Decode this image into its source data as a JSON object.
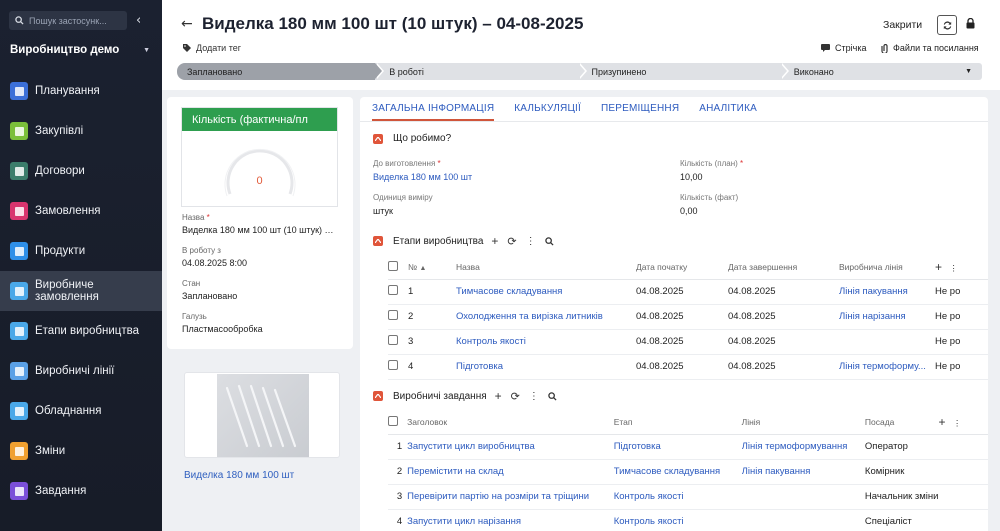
{
  "sidebar": {
    "search_placeholder": "Пошук застосунк...",
    "org": "Виробництво демо",
    "items": [
      {
        "label": "Планування",
        "color": "#3b6fd8",
        "icon": "chart-icon"
      },
      {
        "label": "Закупівлі",
        "color": "#7bbf3a",
        "icon": "doc-icon"
      },
      {
        "label": "Договори",
        "color": "#3b7d6b",
        "icon": "edit-icon"
      },
      {
        "label": "Замовлення",
        "color": "#d8356e",
        "icon": "cart-icon"
      },
      {
        "label": "Продукти",
        "color": "#2f8fe8",
        "icon": "box-icon"
      },
      {
        "label": "Виробниче замовлення",
        "color": "#4aa8e8",
        "icon": "person-icon"
      },
      {
        "label": "Етапи виробництва",
        "color": "#4aa8e8",
        "icon": "list-icon"
      },
      {
        "label": "Виробничі лінії",
        "color": "#5aa0e6",
        "icon": "grid-icon"
      },
      {
        "label": "Обладнання",
        "color": "#4aa8e8",
        "icon": "wrench-icon"
      },
      {
        "label": "Зміни",
        "color": "#f0a030",
        "icon": "calendar-icon"
      },
      {
        "label": "Завдання",
        "color": "#7b4fd8",
        "icon": "flag-icon"
      }
    ]
  },
  "header": {
    "title": "Виделка 180 мм 100 шт (10 штук) – 04-08-2025",
    "close_label": "Закрити",
    "add_tag": "Додати тег",
    "feed": "Стрічка",
    "files": "Файли та посилання"
  },
  "stages": [
    {
      "label": "Заплановано"
    },
    {
      "label": "В роботі"
    },
    {
      "label": "Призупинено"
    },
    {
      "label": "Виконано"
    }
  ],
  "leftcard": {
    "gauge_title": "Кількість (фактична/пл",
    "gauge_value": "0",
    "fields": [
      {
        "label": "Назва",
        "required": "*",
        "value": "Виделка 180 мм 100 шт (10 штук) – 04-08-2025"
      },
      {
        "label": "В роботу з",
        "required": "",
        "value": "04.08.2025 8:00"
      },
      {
        "label": "Стан",
        "required": "",
        "value": "Заплановано"
      },
      {
        "label": "Галузь",
        "required": "",
        "value": "Пластмасообробка"
      }
    ],
    "image_caption": "Виделка 180 мм 100 шт"
  },
  "tabs": [
    "ЗАГАЛЬНА ІНФОРМАЦІЯ",
    "КАЛЬКУЛЯЦІЇ",
    "ПЕРЕМІЩЕННЯ",
    "АНАЛІТИКА"
  ],
  "what": {
    "title": "Що робимо?",
    "f1_label": "До виготовлення",
    "f1_value": "Виделка 180 мм 100 шт",
    "f2_label": "Кількість (план)",
    "f2_value": "10,00",
    "f3_label": "Одиниця виміру",
    "f3_value": "штук",
    "f4_label": "Кількість (факт)",
    "f4_value": "0,00",
    "required": "*"
  },
  "stages_table": {
    "title": "Етапи виробництва",
    "headers": [
      "№",
      "Назва",
      "Дата початку",
      "Дата завершення",
      "Виробнича лінія"
    ],
    "rows": [
      {
        "n": "1",
        "name": "Тимчасове складування",
        "start": "04.08.2025",
        "end": "04.08.2025",
        "line": "Лінія пакування",
        "extra": "Не ро"
      },
      {
        "n": "2",
        "name": "Охолодження та вирізка литників",
        "start": "04.08.2025",
        "end": "04.08.2025",
        "line": "Лінія нарізання",
        "extra": "Не ро"
      },
      {
        "n": "3",
        "name": "Контроль якості",
        "start": "04.08.2025",
        "end": "04.08.2025",
        "line": "",
        "extra": "Не ро"
      },
      {
        "n": "4",
        "name": "Підготовка",
        "start": "04.08.2025",
        "end": "04.08.2025",
        "line": "Лінія термоформу...",
        "extra": "Не ро"
      }
    ]
  },
  "tasks_table": {
    "title": "Виробничі завдання",
    "headers": [
      "Заголовок",
      "Етап",
      "Лінія",
      "Посада"
    ],
    "rows": [
      {
        "n": "1",
        "title": "Запустити цикл виробництва",
        "stage": "Підготовка",
        "line": "Лінія термоформування",
        "role": "Оператор"
      },
      {
        "n": "2",
        "title": "Перемістити на склад",
        "stage": "Тимчасове складування",
        "line": "Лінія пакування",
        "role": "Комірник"
      },
      {
        "n": "3",
        "title": "Перевірити партію на розміри та тріщини",
        "stage": "Контроль якості",
        "line": "",
        "role": "Начальник зміни"
      },
      {
        "n": "4",
        "title": "Запустити цикл нарізання",
        "stage": "Контроль якості",
        "line": "",
        "role": "Спеціаліст"
      }
    ]
  }
}
